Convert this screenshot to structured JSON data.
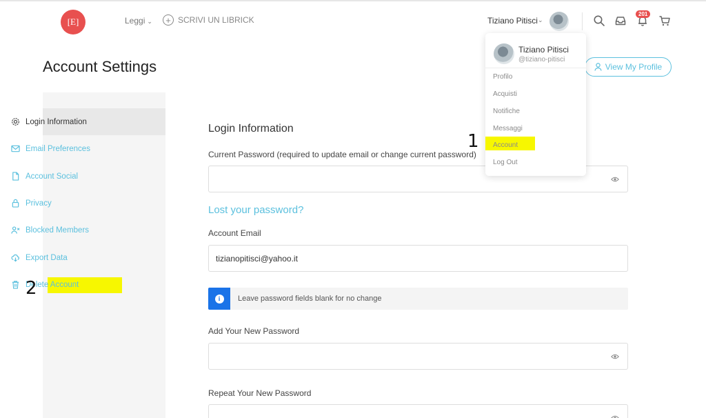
{
  "header": {
    "logo_text": "[E]",
    "nav": {
      "leggi": "Leggi",
      "scrivi": "SCRIVI UN LIBRICK"
    },
    "user": {
      "name": "Tiziano Pitisci"
    },
    "notification_count": "201",
    "icons": [
      "search-icon",
      "inbox-icon",
      "bell-icon",
      "cart-icon"
    ]
  },
  "dropdown": {
    "name": "Tiziano Pitisci",
    "handle": "@tiziano-pitisci",
    "items": [
      "Profilo",
      "Acquisti",
      "Notifiche",
      "Messaggi",
      "Account",
      "Log Out"
    ]
  },
  "annotations": {
    "one": "1",
    "two": "2"
  },
  "page": {
    "title": "Account Settings",
    "view_profile": "View My Profile"
  },
  "sidebar": {
    "items": [
      {
        "label": "Login Information",
        "icon": "gear-icon"
      },
      {
        "label": "Email Preferences",
        "icon": "envelope-icon"
      },
      {
        "label": "Account Social",
        "icon": "document-icon"
      },
      {
        "label": "Privacy",
        "icon": "lock-icon"
      },
      {
        "label": "Blocked Members",
        "icon": "user-block-icon"
      },
      {
        "label": "Export Data",
        "icon": "cloud-download-icon"
      },
      {
        "label": "Delete Account",
        "icon": "trash-icon"
      }
    ]
  },
  "form": {
    "section_title": "Login Information",
    "current_password_label": "Current Password (required to update email or change current password)",
    "lost_password": "Lost your password?",
    "email_label": "Account Email",
    "email_value": "tizianopitisci@yahoo.it",
    "notice": "Leave password fields blank for no change",
    "new_password_label": "Add Your New Password",
    "repeat_password_label": "Repeat Your New Password"
  },
  "colors": {
    "accent": "#5bc0de",
    "brand": "#e8504f",
    "highlight": "#f7f700",
    "info": "#1a73e8"
  }
}
